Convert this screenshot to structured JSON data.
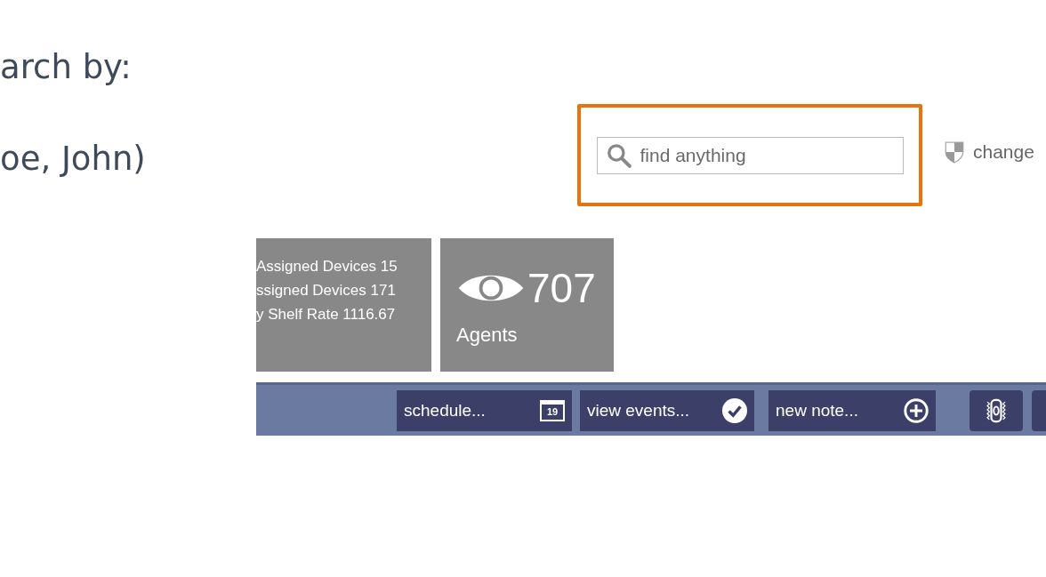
{
  "slide_text": [
    "arch by:",
    "oe, John)"
  ],
  "search": {
    "placeholder": "find anything",
    "highlighted": true
  },
  "change_link": "change",
  "tiles": [
    {
      "kind": "stats",
      "lines": [
        "Assigned Devices 15",
        "ssigned Devices 171",
        "y Shelf Rate 1116.67"
      ]
    },
    {
      "kind": "count",
      "count": "707",
      "label": "Agents"
    }
  ],
  "toolbar": [
    {
      "kind": "calendar",
      "label": "schedule...",
      "icon_text": "19"
    },
    {
      "kind": "check",
      "label": "view events..."
    },
    {
      "kind": "plus",
      "label": "new note..."
    },
    {
      "kind": "device"
    },
    {
      "kind": "blank"
    }
  ]
}
